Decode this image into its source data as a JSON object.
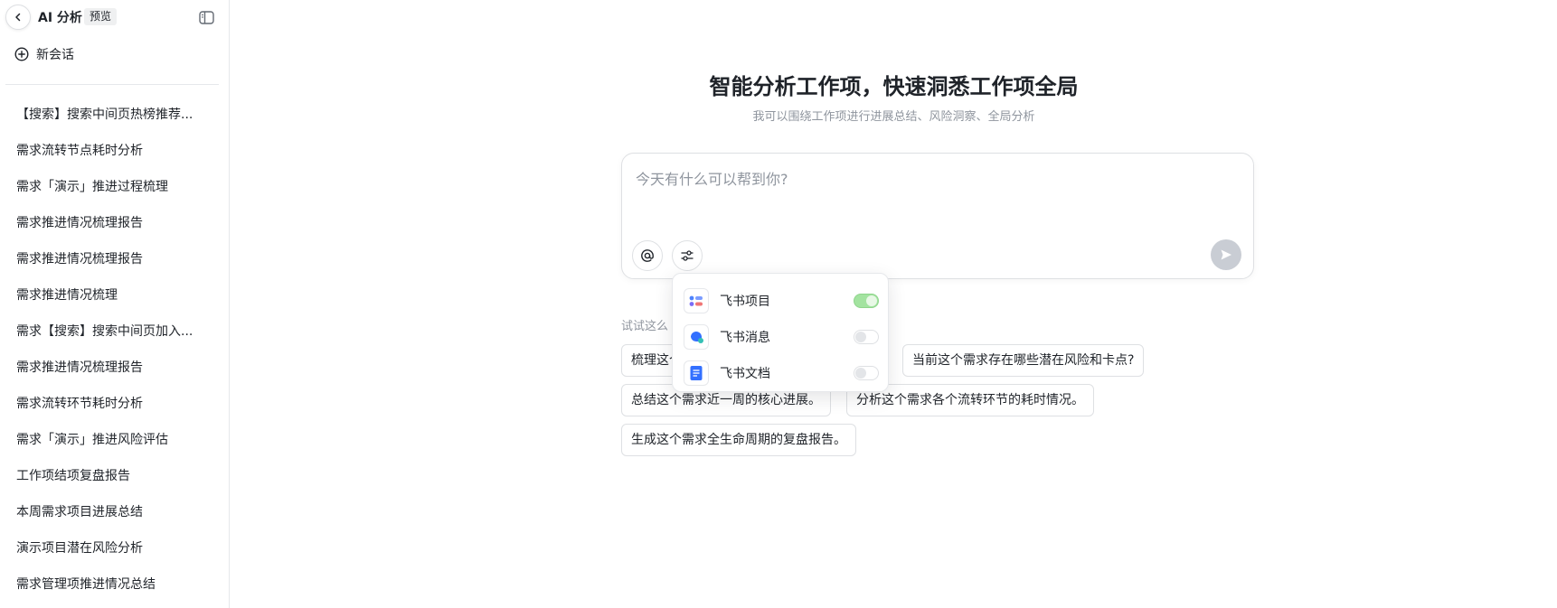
{
  "sidebar": {
    "title": "AI 分析",
    "badge": "预览",
    "new_chat": "新会话",
    "history": [
      "【搜索】搜索中间页热榜推荐...",
      "需求流转节点耗时分析",
      "需求「演示」推进过程梳理",
      "需求推进情况梳理报告",
      "需求推进情况梳理报告",
      "需求推进情况梳理",
      "需求【搜索】搜索中间页加入...",
      "需求推进情况梳理报告",
      "需求流转环节耗时分析",
      "需求「演示」推进风险评估",
      "工作项结项复盘报告",
      "本周需求项目进展总结",
      "演示项目潜在风险分析",
      "需求管理项推进情况总结"
    ]
  },
  "main": {
    "headline": "智能分析工作项，快速洞悉工作项全局",
    "subline": "我可以围绕工作项进行进展总结、风险洞察、全局分析",
    "input_placeholder": "今天有什么可以帮到你?",
    "try_label": "试试这么",
    "suggestions": [
      "梳理这个",
      "当前这个需求存在哪些潜在风险和卡点?",
      "总结这个需求近一周的核心进展。",
      "分析这个需求各个流转环节的耗时情况。",
      "生成这个需求全生命周期的复盘报告。"
    ]
  },
  "popover": {
    "items": [
      {
        "label": "飞书项目",
        "enabled": true
      },
      {
        "label": "飞书消息",
        "enabled": false
      },
      {
        "label": "飞书文档",
        "enabled": false
      }
    ]
  },
  "colors": {
    "toggle_on": "#a3e3a0",
    "send_disabled": "#c9cdd4",
    "doc_blue": "#3370ff"
  },
  "icons": [
    "back-arrow-icon",
    "sidebar-toggle-icon",
    "plus-circle-icon",
    "at-icon",
    "sliders-icon",
    "send-icon",
    "feishu-project-icon",
    "feishu-message-icon",
    "feishu-doc-icon"
  ]
}
